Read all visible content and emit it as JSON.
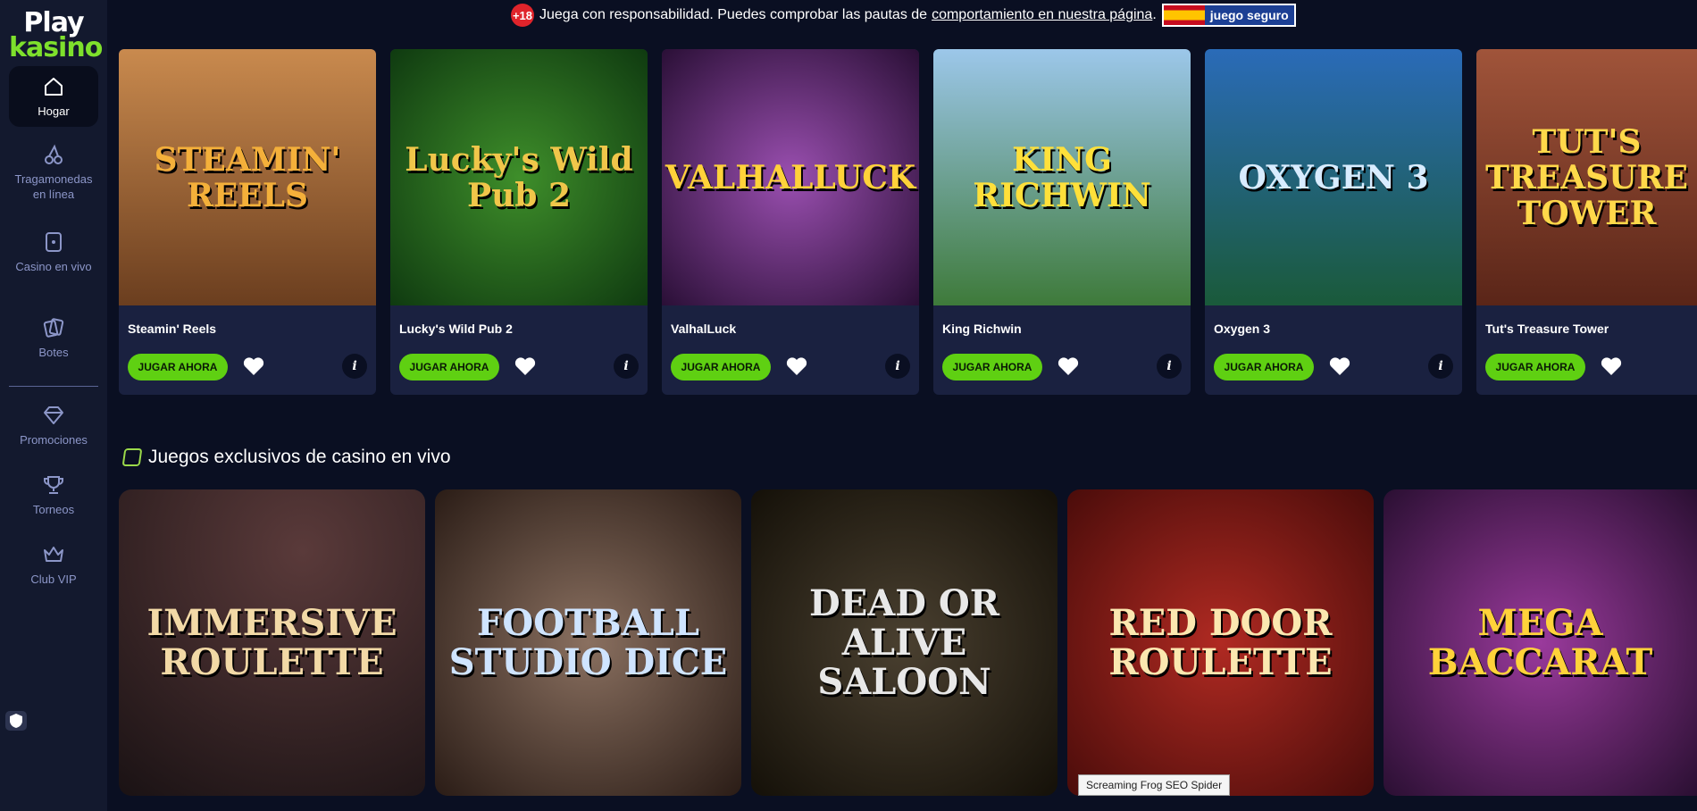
{
  "logo": {
    "line1": "Play",
    "line2": "kasino"
  },
  "sidebar": {
    "items": [
      {
        "label": "Hogar",
        "icon": "home-icon"
      },
      {
        "label": "Tragamonedas en línea",
        "icon": "cherries-icon"
      },
      {
        "label": "Casino en vivo",
        "icon": "card-icon"
      },
      {
        "label": "Botes",
        "icon": "cards-stack-icon"
      },
      {
        "label": "Promociones",
        "icon": "diamond-icon"
      },
      {
        "label": "Torneos",
        "icon": "trophy-icon"
      },
      {
        "label": "Club VIP",
        "icon": "crown-icon"
      }
    ]
  },
  "notice": {
    "badge": "+18",
    "text": "Juega con responsabilidad. Puedes comprobar las pautas de",
    "link": "comportamiento en nuestra página",
    "end": ".",
    "seal": "juego seguro"
  },
  "games": [
    {
      "name": "Steamin' Reels",
      "art": "STEAMIN' REELS",
      "color": "#8a5a33"
    },
    {
      "name": "Lucky's Wild Pub 2",
      "art": "Lucky's Wild Pub 2",
      "color": "#1e5a1c"
    },
    {
      "name": "ValhalLuck",
      "art": "VALHALLUCK",
      "color": "#6a2d6e"
    },
    {
      "name": "King Richwin",
      "art": "KING RICHWIN",
      "color": "#6fa2c9"
    },
    {
      "name": "Oxygen 3",
      "art": "OXYGEN 3",
      "color": "#1d4f8c"
    },
    {
      "name": "Tut's Treasure Tower",
      "art": "TUT'S TREASURE TOWER",
      "color": "#8a3b28"
    }
  ],
  "card_labels": {
    "play": "JUGAR AHORA",
    "info": "i"
  },
  "live_section": {
    "title": "Juegos exclusivos de casino en vivo",
    "games": [
      {
        "art": "IMMERSIVE ROULETTE",
        "color": "#2a1f22"
      },
      {
        "art": "FOOTBALL STUDIO DICE",
        "color": "#3a2a24"
      },
      {
        "art": "DEAD OR ALIVE SALOON",
        "color": "#2a2418"
      },
      {
        "art": "RED DOOR ROULETTE",
        "color": "#7a1714"
      },
      {
        "art": "MEGA BACCARAT",
        "color": "#5a1f5c"
      }
    ]
  },
  "tooltip": "Screaming Frog SEO Spider"
}
